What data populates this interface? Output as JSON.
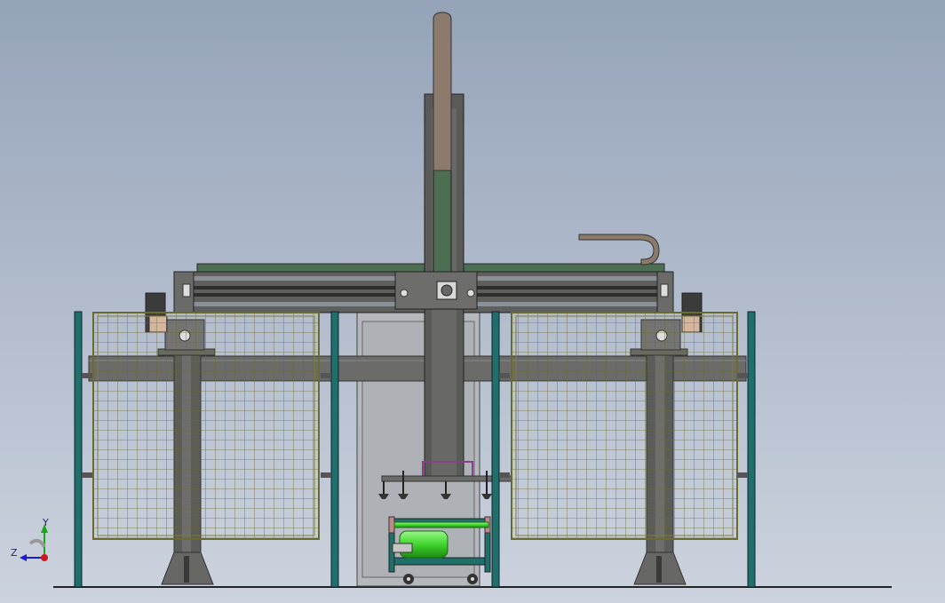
{
  "viewport": {
    "background_top": "#95a3b9",
    "background_bottom": "#ccd3de"
  },
  "model": {
    "fence_post_color": "#1f6f6a",
    "frame_color": "#5c5c5a",
    "rail_accent_color": "#4d6e52",
    "mesh_color": "#6b6b2f",
    "cylinder_color": "#3fd62c",
    "gripper_color": "#8a3f8c",
    "arm_top_color": "#8c7a6c"
  },
  "triad": {
    "y_label": "Y",
    "z_label": "Z",
    "y_color": "#17a717",
    "z_color": "#1a1ad0",
    "x_color": "#d01a1a"
  }
}
